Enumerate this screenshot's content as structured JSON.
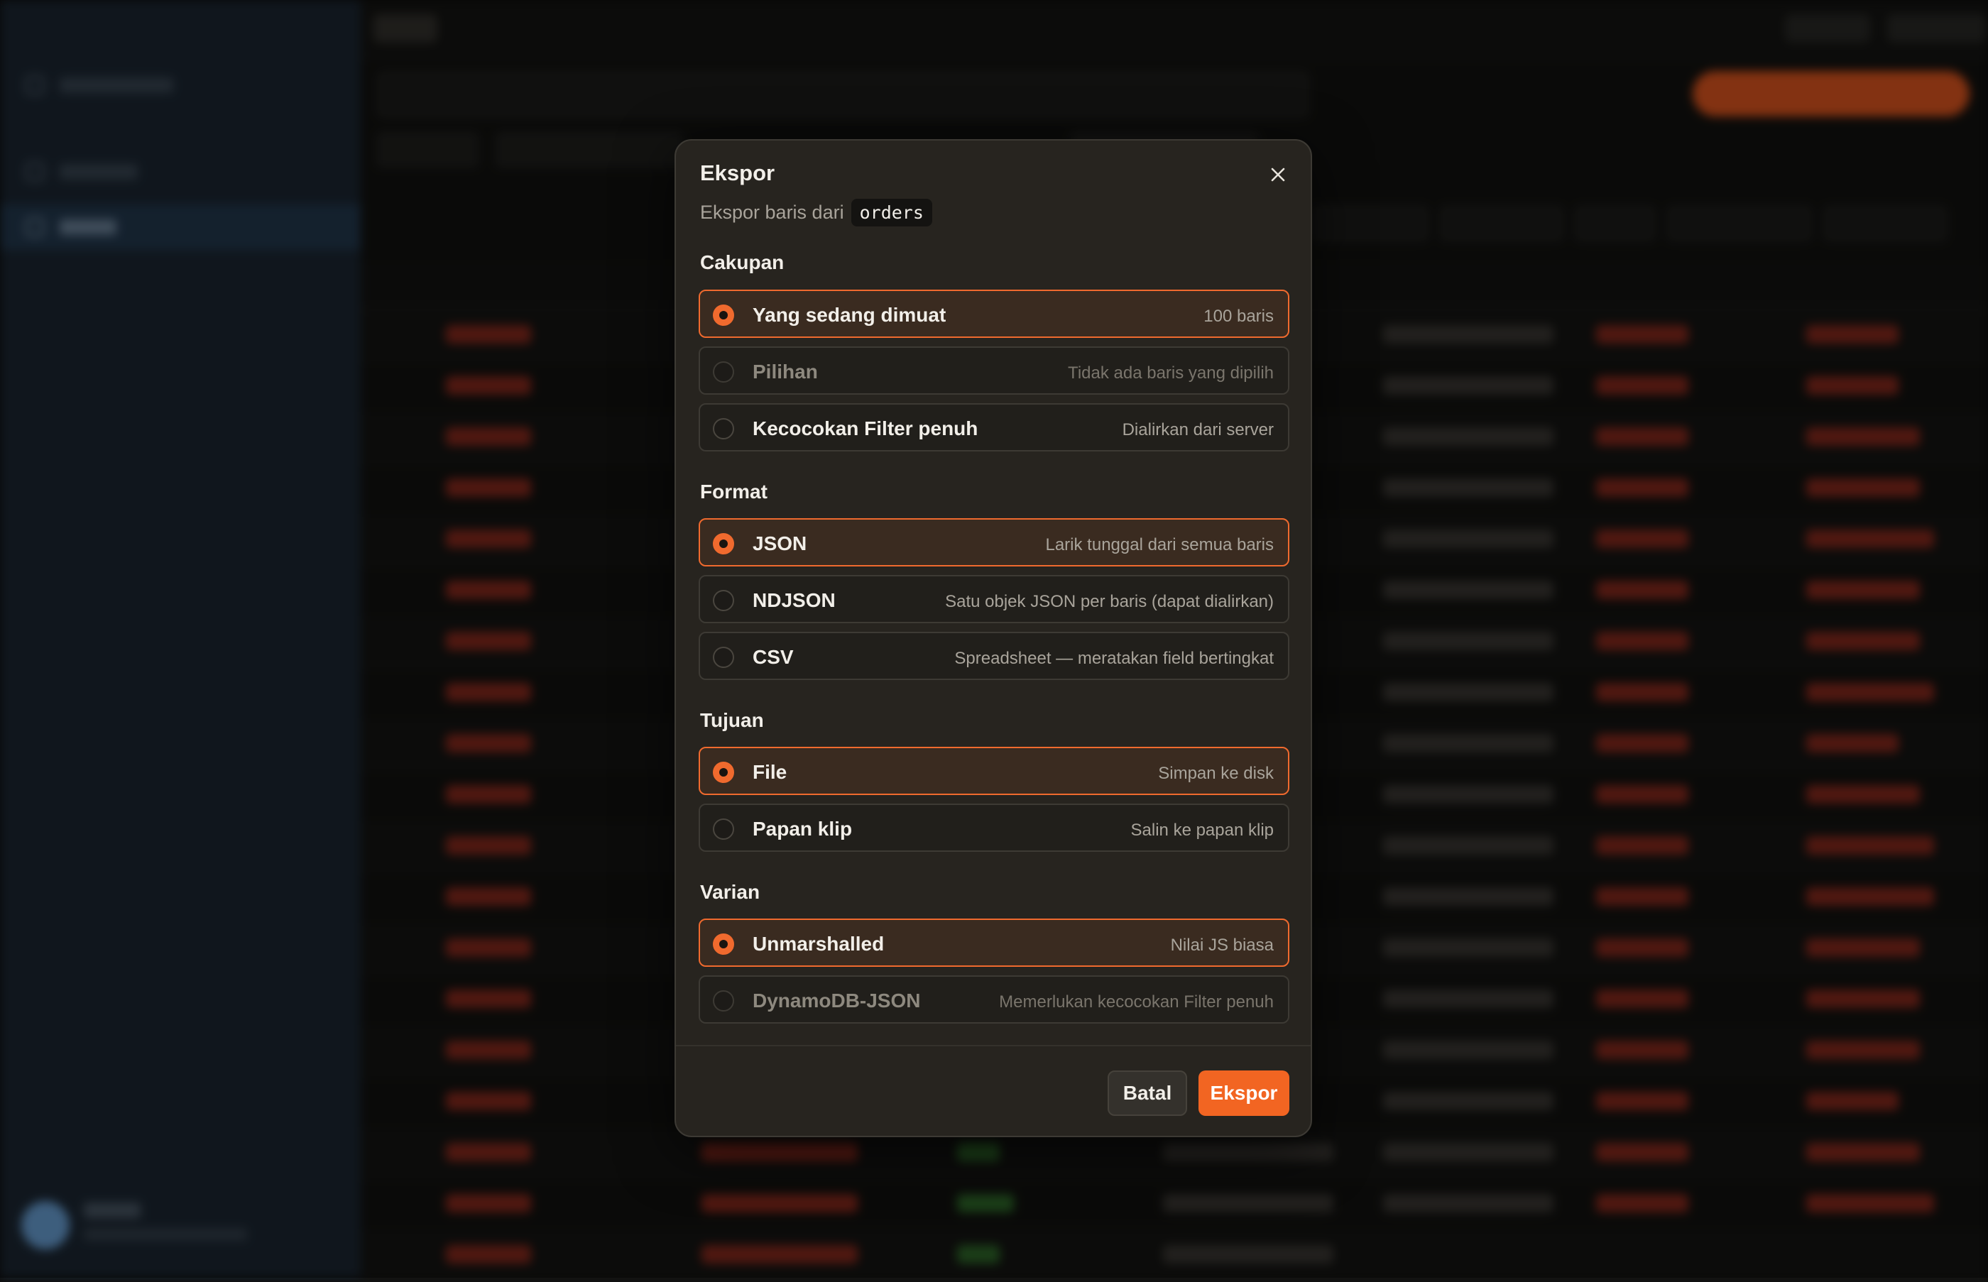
{
  "dialog": {
    "title": "Ekspor",
    "subtitle": "Ekspor baris dari",
    "table_name": "orders",
    "sections": [
      {
        "label": "Cakupan",
        "options": [
          {
            "label": "Yang sedang dimuat",
            "description": "100 baris",
            "selected": true,
            "disabled": false
          },
          {
            "label": "Pilihan",
            "description": "Tidak ada baris yang dipilih",
            "selected": false,
            "disabled": true
          },
          {
            "label": "Kecocokan Filter penuh",
            "description": "Dialirkan dari server",
            "selected": false,
            "disabled": false
          }
        ]
      },
      {
        "label": "Format",
        "options": [
          {
            "label": "JSON",
            "description": "Larik tunggal dari semua baris",
            "selected": true,
            "disabled": false
          },
          {
            "label": "NDJSON",
            "description": "Satu objek JSON per baris (dapat dialirkan)",
            "selected": false,
            "disabled": false
          },
          {
            "label": "CSV",
            "description": "Spreadsheet — meratakan field bertingkat",
            "selected": false,
            "disabled": false
          }
        ]
      },
      {
        "label": "Tujuan",
        "options": [
          {
            "label": "File",
            "description": "Simpan ke disk",
            "selected": true,
            "disabled": false
          },
          {
            "label": "Papan klip",
            "description": "Salin ke papan klip",
            "selected": false,
            "disabled": false
          }
        ]
      },
      {
        "label": "Varian",
        "options": [
          {
            "label": "Unmarshalled",
            "description": "Nilai JS biasa",
            "selected": true,
            "disabled": false
          },
          {
            "label": "DynamoDB-JSON",
            "description": "Memerlukan kecocokan Filter penuh",
            "selected": false,
            "disabled": true
          }
        ]
      }
    ],
    "cancel_label": "Batal",
    "export_label": "Ekspor"
  },
  "colors": {
    "accent": "#f26522",
    "dialog_bg": "#27241f",
    "selected_bg": "#3a2b20"
  },
  "icons": {
    "close": "close-icon"
  }
}
